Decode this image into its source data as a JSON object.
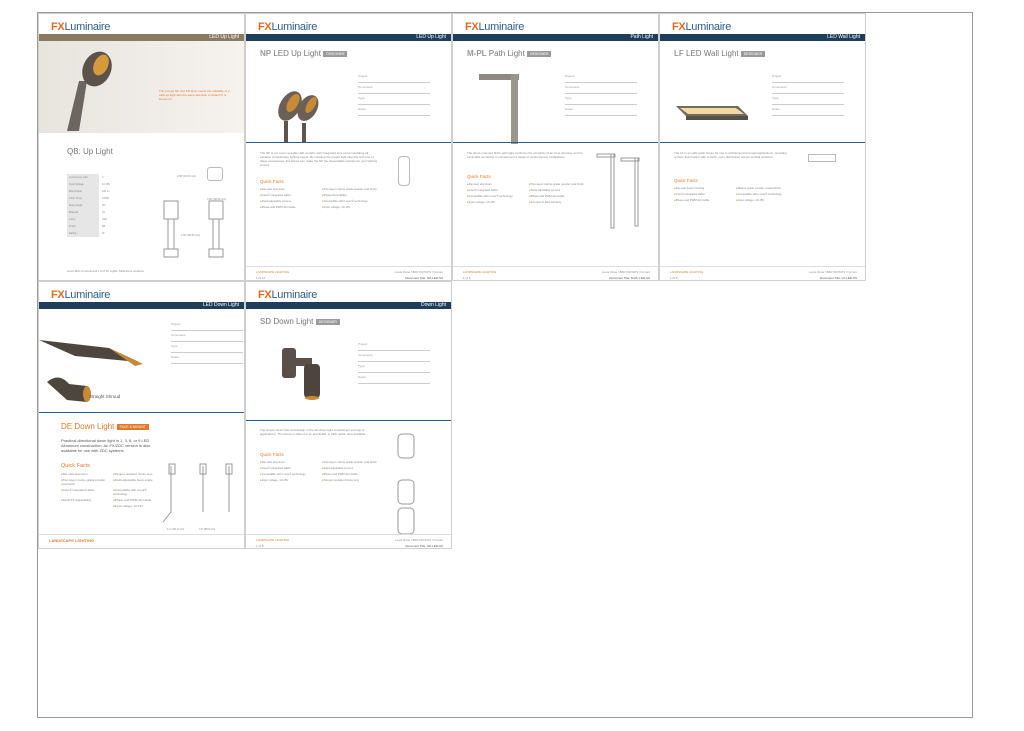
{
  "brand": {
    "fx": "FX",
    "luminaire": "Luminaire",
    "accent": "#e06a1f",
    "navy": "#1e3e5c"
  },
  "pages": {
    "qb": {
      "bar_label": "LED Up Light",
      "hero_text": "The proven NP and PR lamp meets the reliability of a LED up-light with the same attention to detail FX is known for.",
      "title": "QB: Up Light",
      "spec_rows": [
        {
          "k": "Lumens per watt",
          "v": "3"
        },
        {
          "k": "Input Voltage",
          "v": "10-15V"
        },
        {
          "k": "Max Output",
          "v": "160 lm"
        },
        {
          "k": "Color Temp",
          "v": "2700K"
        },
        {
          "k": "Beam Angle",
          "v": "35°"
        },
        {
          "k": "Material",
          "v": "Cu"
        },
        {
          "k": "Lamp",
          "v": "LED"
        },
        {
          "k": "Finish",
          "v": "BZ"
        },
        {
          "k": "Rating",
          "v": "IP"
        }
      ],
      "dim1": "2.50\" [63.50 mm]",
      "dim2": "3.50\" [88.90 mm]",
      "dim3": "2.00\" [50.80 mm]",
      "footnote": "Luxor ZDC Controls and 1 to 8 FX Lights. Multi-Zone products."
    },
    "np": {
      "bar_label": "LED Up Light",
      "code": "NP",
      "name": "LED Up Light",
      "tag": "DESIGNER",
      "form_fields": [
        "Project",
        "Comments",
        "Type",
        "Notes"
      ],
      "description": "The NP is our most versatile LED up light, with integrated lens accommodating all varieties of landscape lighting needs. By coupling the proper light intensity with one of these accessories, this fixture can make the NP the dependable solution for your lighting project.",
      "quick_facts_title": "Quick Facts",
      "quick_facts": [
        "Die-cast aluminum",
        "Two-layer marine-grade powder coat finish",
        "Cree® integrated LEDs",
        "Phase Dimmability",
        "Field adjustable lumens",
        "Compatible with Luxor® technology",
        "Phase and PWM dimmable",
        "Input voltage: 10-15V"
      ],
      "footer_left": "LANDSCAPE LIGHTING",
      "footer_right": "Luxor Zone / 800.733.5473 / fxl.com",
      "footer_left2": "1 of 12",
      "footer_right2": "Document Title: NP-LED-SS"
    },
    "mpl": {
      "bar_label": "Path Light",
      "code": "M-PL",
      "name": "Path Light",
      "tag": "DESIGNER",
      "form_fields": [
        "Project",
        "Comments",
        "Type",
        "Notes"
      ],
      "description": "The direct-mounted M-PL path light combines the simplicity of an inset structure and its minimalist sensitivity to complement a range of contemporary installations.",
      "quick_facts_title": "Quick Facts",
      "quick_facts": [
        "Die-cast aluminum",
        "Two-layer marine-grade powder coat finish",
        "Cree® integrated LEDs",
        "Field adjustable lumens",
        "Compatible with Luxor® technology",
        "Phase and PWM dimmable",
        "Input voltage: 10-15V",
        "1/4 year of field warranty"
      ],
      "footer_left": "LANDSCAPE LIGHTING",
      "footer_right": "Luxor Zone / 800.733.5473 / fxl.com",
      "footer_left2": "1 of 6",
      "footer_right2": "Document Title: M-PL-LED-SS"
    },
    "lf": {
      "bar_label": "LED Wall Light",
      "code": "LF",
      "name": "LED Wall Light",
      "tag": "DESIGNER",
      "form_fields": [
        "Project",
        "Comments",
        "Type",
        "Notes"
      ],
      "description": "The LF is an LED wash fixture for use in architectural and wall applications, providing uniform illumination with smooth, even distribution across vertical surfaces.",
      "quick_facts_title": "Quick Facts",
      "quick_facts": [
        "Die-cast brass housing",
        "Marine-grade powder coated finish",
        "Cree® integrated LEDs",
        "Compatible with Luxor® technology",
        "Phase and PWM dimmable",
        "Input voltage: 10-15V"
      ],
      "footer_left": "LANDSCAPE LIGHTING",
      "footer_right": "Luxor Zone / 800.733.5473 / fxl.com",
      "footer_left2": "1 of 8",
      "footer_right2": "Document Title: LF-LED-SS"
    },
    "de": {
      "bar_label": "LED Down Light",
      "form_fields": [
        "Project",
        "Comments",
        "Type",
        "Notes"
      ],
      "caption": "Straight Shroud",
      "title_code": "DE",
      "title_name": "Down Light",
      "tag": "FACE & MOUNT",
      "description": "Practical directional down light in 1, 3, 6, or 9 LED Aluminum construction. An FX/ZDC version is also available for use with ZDC systems.",
      "quick_facts_title": "Quick Facts",
      "quick_facts": [
        "Die-cast aluminum",
        "Tamper-resistant fixture lens",
        "Two-layer marine-grade powder coat finish",
        "Field-adjustable beam angle",
        "Cree® integrated LEDs",
        "Compatible with Luxor® technology",
        "FluxFX® adjustability",
        "Phase and PWM dimmable",
        "",
        "Input voltage: 10-15V"
      ],
      "dim_a": "4.4\" [111.8 mm]",
      "dim_b": "3.5\" [88.9 mm]",
      "footer_left": "LANDSCAPE LIGHTING"
    },
    "sd": {
      "bar_label": "Down Light",
      "code": "SD",
      "name": "Down Light",
      "tag": "DESIGNER",
      "form_fields": [
        "Project",
        "Comments",
        "Type",
        "Notes"
      ],
      "description": "The simple clean lines and design of the SD down light complement a range of applications. The fixture is offered in 1L and 3LED, in ZDC option also available.",
      "quick_facts_title": "Quick Facts",
      "quick_facts": [
        "Die-cast aluminum",
        "Two-layer marine-grade powder coat finish",
        "Cree® integrated LEDs",
        "Field adjustable lumens",
        "Compatible with Luxor® technology",
        "Phase and PWM dimmable",
        "Input voltage: 10-15V",
        "Tamper-resistant fixture lens"
      ],
      "footer_left": "LANDSCAPE LIGHTING",
      "footer_right": "Luxor Zone / 800.733.5473 / fxl.com",
      "footer_left2": "1 of 8",
      "footer_right2": "Document Title: SD-LED-SS"
    }
  }
}
